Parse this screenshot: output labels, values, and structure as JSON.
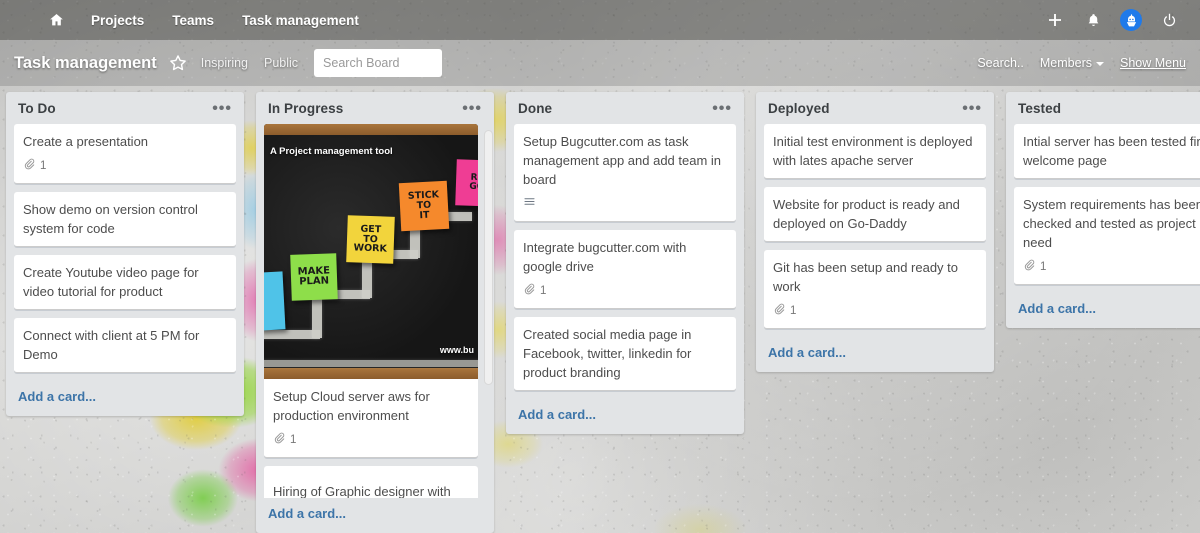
{
  "nav": {
    "home_icon": "home-icon",
    "items": [
      {
        "label": "Projects"
      },
      {
        "label": "Teams"
      },
      {
        "label": "Task management"
      }
    ],
    "right_icons": [
      {
        "name": "plus-icon",
        "glyph": "+"
      },
      {
        "name": "bell-icon",
        "glyph": "bell"
      },
      {
        "name": "user-avatar-icon",
        "glyph": "bug-avatar"
      },
      {
        "name": "power-icon",
        "glyph": "power"
      }
    ],
    "accent_color": "#1f7aea"
  },
  "board": {
    "title": "Task management",
    "star_icon": "star-icon",
    "visibility_label": "Inspiring",
    "public_label": "Public",
    "search": {
      "placeholder": "Search Board",
      "value": ""
    },
    "actions": {
      "search_label": "Search..",
      "members_label": "Members",
      "show_menu_label": "Show Menu"
    },
    "add_card_label": "Add a card..."
  },
  "lists": [
    {
      "title": "To Do",
      "menu": "•••",
      "cards": [
        {
          "title": "Create a presentation",
          "badge_icon": "attachment-icon",
          "badge_count": "1"
        },
        {
          "title": "Show demo on version control system for code"
        },
        {
          "title": "Create Youtube video page for video tutorial for product"
        },
        {
          "title": "Connect with client at 5 PM for Demo"
        }
      ]
    },
    {
      "title": "In Progress",
      "menu": "•••",
      "cards": [
        {
          "title": "Setup Cloud server aws for production environment",
          "badge_icon": "attachment-icon",
          "badge_count": "1",
          "cover": {
            "label": "A Project management tool",
            "watermark": "www.bu",
            "notes": [
              {
                "text": "MAKE PLAN",
                "color": "#8ede4a"
              },
              {
                "text": "GET TO WORK",
                "color": "#f2d43c"
              },
              {
                "text": "STICK TO IT",
                "color": "#f5892c"
              },
              {
                "text": "RE GO",
                "color": "#ef3d94"
              }
            ]
          }
        },
        {
          "title": "Hiring of Graphic designer with",
          "clipped": true
        }
      ]
    },
    {
      "title": "Done",
      "menu": "•••",
      "cards": [
        {
          "title": "Setup Bugcutter.com as task management app and add team in board",
          "badge_icon": "description-icon"
        },
        {
          "title": "Integrate bugcutter.com with google drive",
          "badge_icon": "attachment-icon",
          "badge_count": "1"
        },
        {
          "title": "Created social media page in Facebook, twitter, linkedin for product branding"
        }
      ]
    },
    {
      "title": "Deployed",
      "menu": "•••",
      "cards": [
        {
          "title": "Initial test environment is deployed with lates apache server"
        },
        {
          "title": "Website for product is ready and deployed on Go-Daddy"
        },
        {
          "title": "Git has been setup and ready to work",
          "badge_icon": "attachment-icon",
          "badge_count": "1"
        }
      ]
    },
    {
      "title": "Tested",
      "menu": "",
      "cards": [
        {
          "title": "Intial server has been tested first welcome page"
        },
        {
          "title": "System requirements has been checked and tested as project need",
          "badge_icon": "attachment-icon",
          "badge_count": "1"
        }
      ]
    }
  ]
}
